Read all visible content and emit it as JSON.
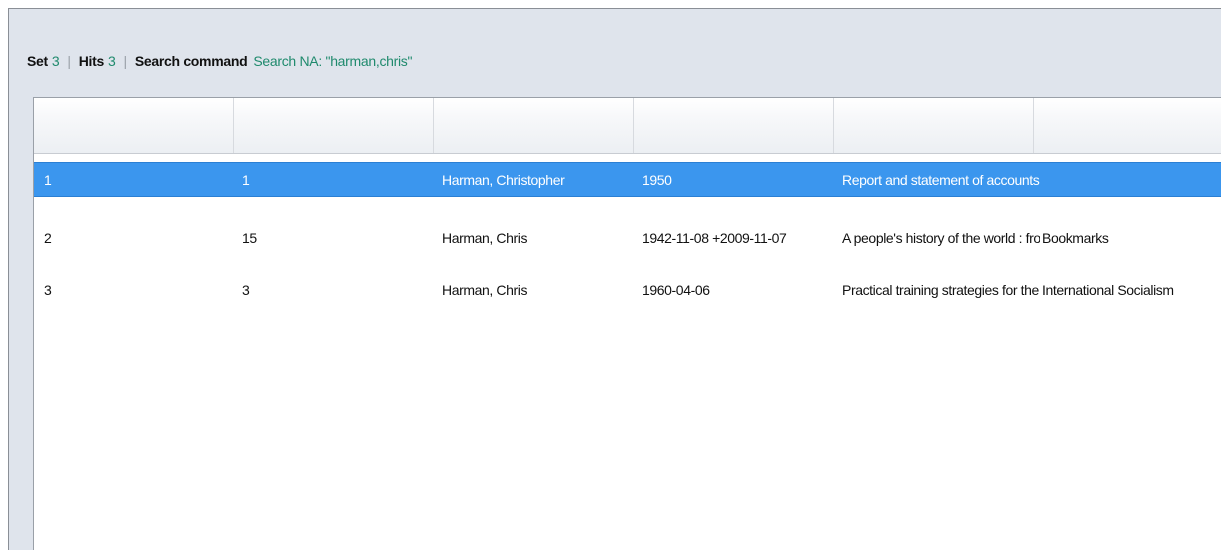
{
  "status": {
    "set_label": "Set",
    "set_value": "3",
    "hits_label": "Hits",
    "hits_value": "3",
    "command_label": "Search command",
    "command_value": "Search NA: \"harman,chris\""
  },
  "table": {
    "columns": [
      "",
      "",
      "",
      "",
      "",
      ""
    ],
    "rows": [
      {
        "cells": [
          "1",
          "1",
          "Harman, Christopher",
          "1950",
          "Report and statement of accounts f...",
          ""
        ],
        "selected": true
      },
      {
        "cells": [
          "2",
          "15",
          "Harman, Chris",
          "1942-11-08 +2009-11-07",
          "A people's history of the world : fro...",
          "Bookmarks"
        ],
        "selected": false
      },
      {
        "cells": [
          "3",
          "3",
          "Harman, Chris",
          "1960-04-06",
          "Practical training strategies for the f...",
          "International Socialism"
        ],
        "selected": false
      }
    ]
  },
  "colors": {
    "selected_row": "#3b96ee",
    "status_value": "#1f8a6d",
    "frame_bg": "#dfe4ec"
  }
}
